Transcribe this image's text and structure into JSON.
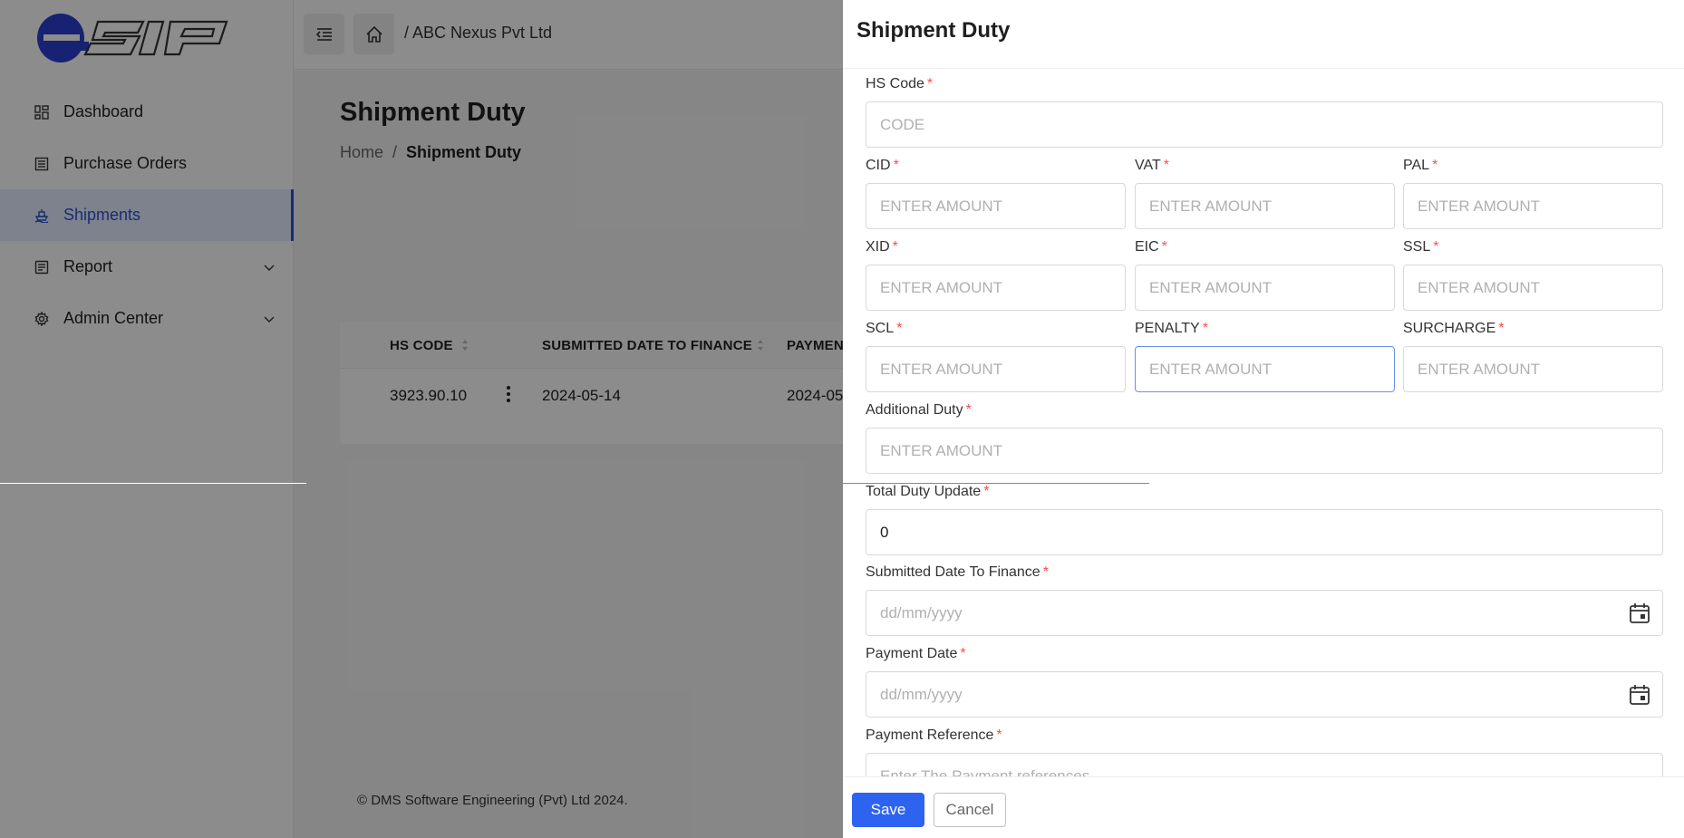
{
  "app": {
    "logo_text": "eSIP",
    "company_breadcrumb": "/ ABC Nexus Pvt Ltd",
    "brand_color": "#2952d6"
  },
  "sidebar": {
    "items": [
      {
        "label": "Dashboard",
        "icon": "dashboard-icon"
      },
      {
        "label": "Purchase Orders",
        "icon": "list-icon"
      },
      {
        "label": "Shipments",
        "icon": "ship-icon",
        "active": true
      },
      {
        "label": "Report",
        "icon": "report-icon",
        "expandable": true
      },
      {
        "label": "Admin Center",
        "icon": "gear-icon",
        "expandable": true
      }
    ]
  },
  "page": {
    "title": "Shipment Duty",
    "breadcrumb": {
      "home": "Home",
      "separator": "/",
      "current": "Shipment Duty"
    }
  },
  "table": {
    "headers": [
      "HS CODE",
      "SUBMITTED DATE TO FINANCE",
      "PAYMEN"
    ],
    "rows": [
      {
        "hs_code": "3923.90.10",
        "submitted_date": "2024-05-14",
        "payment_date": "2024-05"
      }
    ]
  },
  "footer": {
    "copyright": "© DMS Software Engineering (Pvt) Ltd 2024."
  },
  "drawer": {
    "title": "Shipment Duty",
    "fields": {
      "hs_code": {
        "label": "HS Code",
        "placeholder": "CODE"
      },
      "cid": {
        "label": "CID",
        "placeholder": "ENTER AMOUNT"
      },
      "vat": {
        "label": "VAT",
        "placeholder": "ENTER AMOUNT"
      },
      "pal": {
        "label": "PAL",
        "placeholder": "ENTER AMOUNT"
      },
      "xid": {
        "label": "XID",
        "placeholder": "ENTER AMOUNT"
      },
      "eic": {
        "label": "EIC",
        "placeholder": "ENTER AMOUNT"
      },
      "ssl": {
        "label": "SSL",
        "placeholder": "ENTER AMOUNT"
      },
      "scl": {
        "label": "SCL",
        "placeholder": "ENTER AMOUNT"
      },
      "penalty": {
        "label": "PENALTY",
        "placeholder": "ENTER AMOUNT"
      },
      "surcharge": {
        "label": "SURCHARGE",
        "placeholder": "ENTER AMOUNT"
      },
      "additional_duty": {
        "label": "Additional Duty",
        "placeholder": "ENTER AMOUNT"
      },
      "total_duty_update": {
        "label": "Total Duty Update",
        "value": "0"
      },
      "submitted_date": {
        "label": "Submitted Date To Finance",
        "placeholder": "dd/mm/yyyy"
      },
      "payment_date": {
        "label": "Payment Date",
        "placeholder": "dd/mm/yyyy"
      },
      "payment_reference": {
        "label": "Payment Reference",
        "placeholder": "Enter The Payment references"
      }
    },
    "required_mark": "*",
    "save_label": "Save",
    "cancel_label": "Cancel"
  }
}
